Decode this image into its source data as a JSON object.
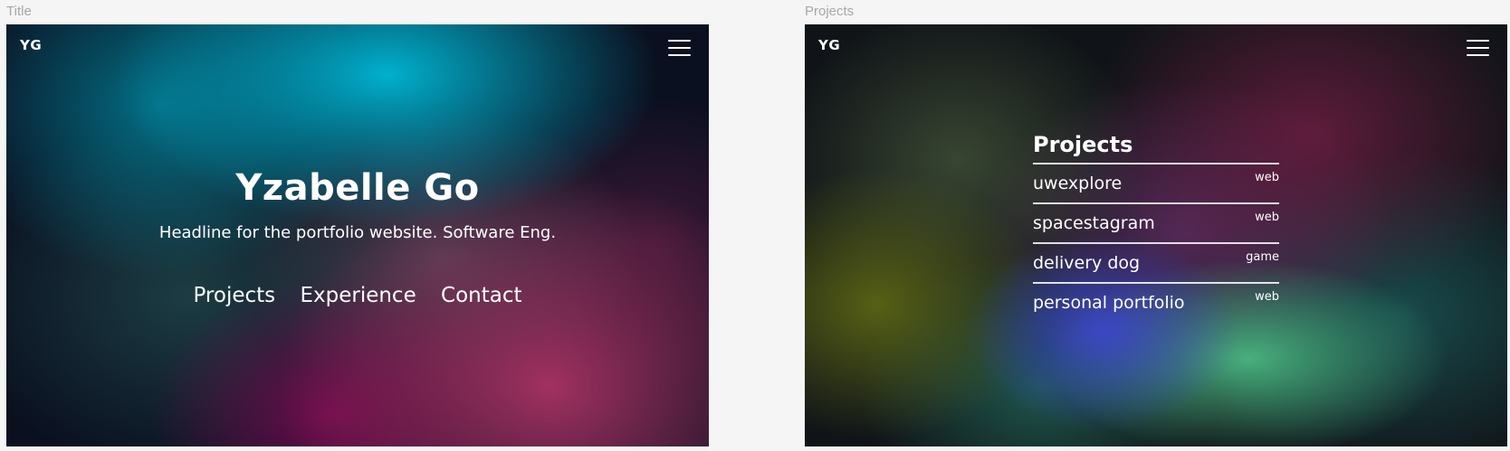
{
  "frames": {
    "title": {
      "label": "Title"
    },
    "projects": {
      "label": "Projects"
    }
  },
  "logo": "YG",
  "menu_icon": "hamburger-menu-icon",
  "hero": {
    "name": "Yzabelle Go",
    "headline": "Headline for the portfolio website. Software Eng.",
    "nav": [
      "Projects",
      "Experience",
      "Contact"
    ]
  },
  "projects_section": {
    "heading": "Projects",
    "items": [
      {
        "name": "uwexplore",
        "tag": "web"
      },
      {
        "name": "spacestagram",
        "tag": "web"
      },
      {
        "name": "delivery dog",
        "tag": "game"
      },
      {
        "name": "personal portfolio",
        "tag": "web"
      }
    ]
  },
  "colors": {
    "canvas": "#f5f5f5",
    "frame_label": "#a8a8a8",
    "text": "#ffffff"
  }
}
